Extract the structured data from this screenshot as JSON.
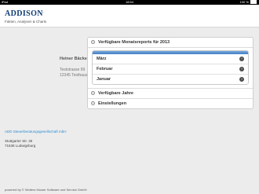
{
  "status_bar": {
    "device": "iPad",
    "time": "18:54",
    "battery": "100 %"
  },
  "header": {
    "logo": "ADDISON",
    "subtitle": "Fakten, Analysen & Charts"
  },
  "person": {
    "name": "Heiner Bäcker",
    "street": "Teststrasse 99",
    "city": "12345 Testhausen"
  },
  "company": {
    "name": "ADD Steuerberatungsgesellschaft mbH",
    "street": "Stuttgarter Str. 35",
    "city": "71638 Ludwigsburg"
  },
  "footer": {
    "text": "powered by © Wolters Kluwer Software und Service GmbH"
  },
  "panel": {
    "reports_title": "Verfügbare Monatsreports für 2013",
    "months": [
      "März",
      "Februar",
      "Januar"
    ],
    "years_title": "Verfügbare Jahre",
    "settings_title": "Einstellungen"
  }
}
